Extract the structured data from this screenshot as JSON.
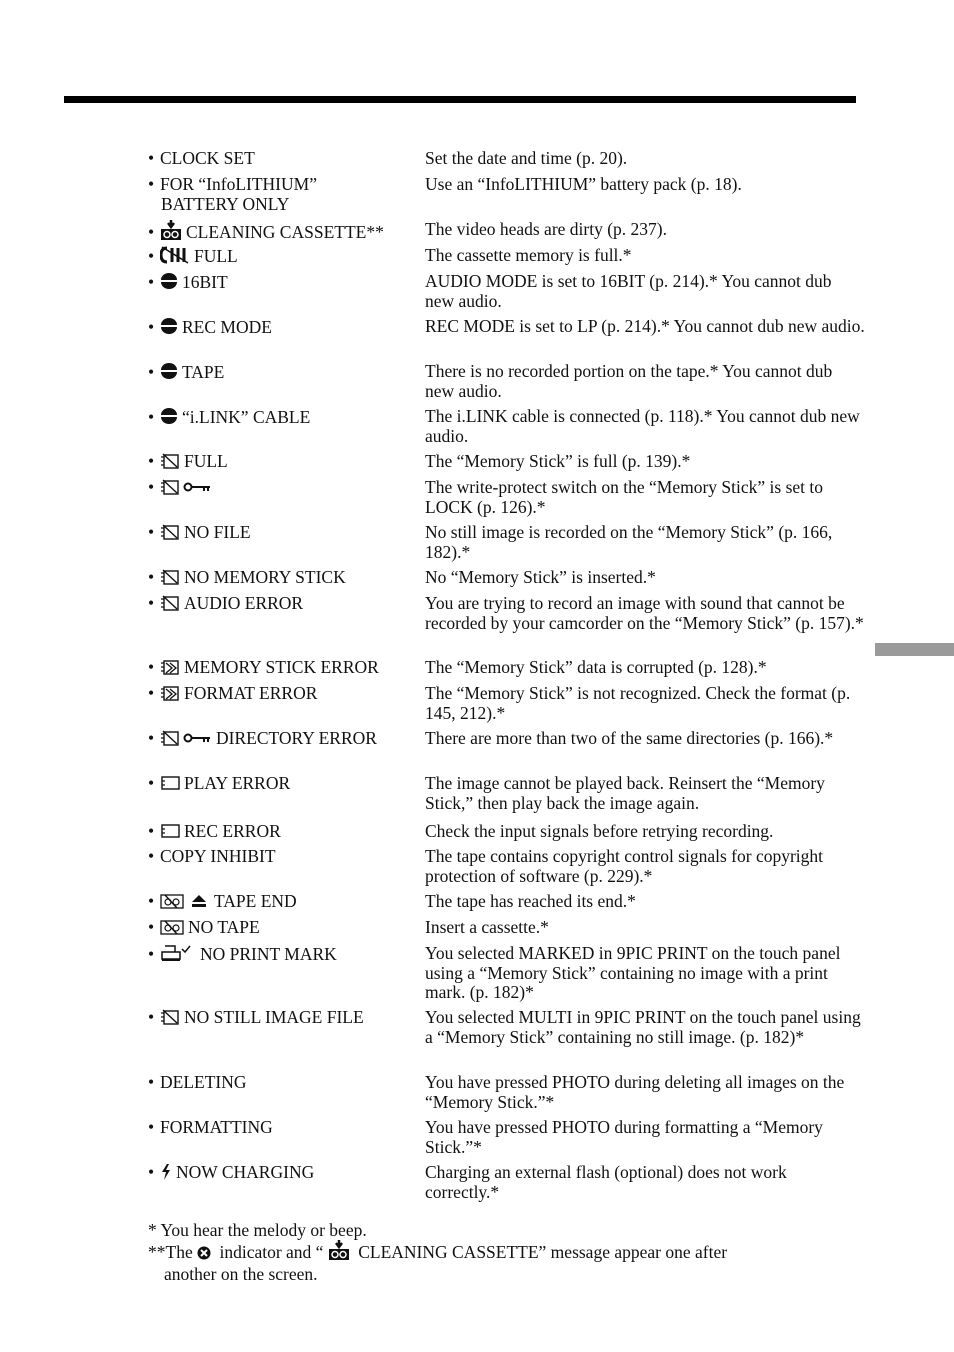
{
  "rows": [
    {
      "icon": "",
      "label": "CLOCK SET",
      "desc": "Set the date and time (p. 20)."
    },
    {
      "icon": "",
      "label": "FOR “InfoLITHIUM”\nBATTERY ONLY",
      "desc": "Use an “InfoLITHIUM” battery pack (p. 18)."
    },
    {
      "icon": "cleaning-cassette-icon",
      "label": "CLEANING CASSETTE**",
      "desc": "The video heads are dirty (p. 237)."
    },
    {
      "icon": "cassette-memory-icon",
      "label": "FULL",
      "desc": "The cassette memory is full.*"
    },
    {
      "icon": "audio-dub-icon",
      "label": "16BIT",
      "desc": "AUDIO MODE is set to 16BIT (p. 214).* You cannot dub new audio."
    },
    {
      "icon": "audio-dub-icon",
      "label": "REC MODE",
      "desc": "REC MODE is set to LP (p. 214).* You cannot dub new audio."
    },
    {
      "icon": "audio-dub-icon",
      "label": "TAPE",
      "desc": "There is no recorded portion on the tape.* You cannot dub new audio."
    },
    {
      "icon": "audio-dub-icon",
      "label": "“i.LINK” CABLE",
      "desc": "The i.LINK cable is connected (p. 118).* You cannot dub new audio."
    },
    {
      "icon": "memory-stick-icon",
      "label": "FULL",
      "desc": "The “Memory Stick” is full (p. 139).*"
    },
    {
      "icon": "memory-stick-key-icon",
      "label": "",
      "desc": "The write-protect switch on the “Memory Stick” is set to LOCK (p. 126).*"
    },
    {
      "icon": "memory-stick-icon",
      "label": "NO FILE",
      "desc": "No still image is recorded on the “Memory Stick” (p. 166, 182).*"
    },
    {
      "icon": "memory-stick-icon",
      "label": "NO MEMORY STICK",
      "desc": "No “Memory Stick” is inserted.*"
    },
    {
      "icon": "memory-stick-icon",
      "label": "AUDIO ERROR",
      "desc": "You are trying to record an image with sound that cannot be recorded by your camcorder on the “Memory Stick” (p. 157).*"
    },
    {
      "icon": "memory-stick-error-icon",
      "label": "MEMORY STICK ERROR",
      "desc": "The “Memory Stick” data is corrupted (p. 128).*"
    },
    {
      "icon": "memory-stick-error-icon",
      "label": "FORMAT ERROR",
      "desc": "The “Memory Stick” is not recognized. Check the format (p. 145, 212).*"
    },
    {
      "icon": "memory-stick-key-icon",
      "label": "DIRECTORY ERROR",
      "desc": "There are more than two of the same directories (p. 166).*"
    },
    {
      "icon": "card-icon",
      "label": "PLAY ERROR",
      "desc": "The image cannot be played back. Reinsert the “Memory Stick,” then play back the image again."
    },
    {
      "icon": "card-icon",
      "label": "REC ERROR",
      "desc": "Check the input signals before retrying recording."
    },
    {
      "icon": "",
      "label": "COPY INHIBIT",
      "desc": "The tape contains copyright control signals for copyright protection of software (p. 229).*"
    },
    {
      "icon": "no-tape-eject-icon",
      "label": "TAPE END",
      "desc": "The tape has reached its end.*"
    },
    {
      "icon": "no-tape-icon",
      "label": "NO TAPE",
      "desc": "Insert a cassette.*"
    },
    {
      "icon": "print-mark-icon",
      "label": "NO PRINT MARK",
      "desc": "You selected MARKED in 9PIC PRINT on the touch panel using a “Memory Stick” containing no image with a print mark. (p. 182)*"
    },
    {
      "icon": "memory-stick-icon",
      "label": "NO STILL IMAGE FILE",
      "desc": "You selected MULTI in 9PIC PRINT on the touch panel using a “Memory Stick” containing no still image. (p. 182)*"
    },
    {
      "icon": "",
      "label": "DELETING",
      "desc": "You have pressed PHOTO during deleting all images on the “Memory Stick.”*"
    },
    {
      "icon": "",
      "label": "FORMATTING",
      "desc": "You have pressed PHOTO during formatting a “Memory Stick.”*"
    },
    {
      "icon": "flash-icon",
      "label": "NOW CHARGING",
      "desc": "Charging an external flash (optional) does not work correctly.*"
    }
  ],
  "footnotes": {
    "note1": "*  You hear the melody or beep.",
    "note2_a": "**The ",
    "note2_b": " indicator and “ ",
    "note2_c": " CLEANING CASSETTE” message appear one after",
    "note2_d": "another on the screen."
  }
}
